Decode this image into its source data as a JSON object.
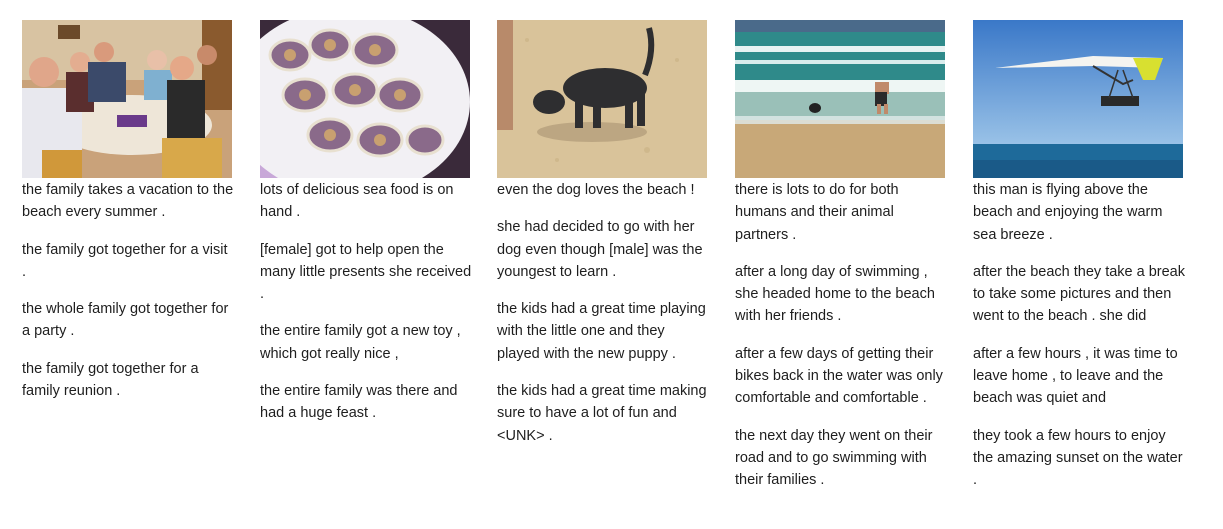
{
  "stories": [
    {
      "image": "family dinner around table",
      "captions": [
        "the family takes a vacation to the beach every summer .",
        "the family got together for a visit .",
        "the whole family got together for a party .",
        "the family got together for a family reunion ."
      ]
    },
    {
      "image": "plate of oysters",
      "captions": [
        "lots of delicious sea food is on hand .",
        "[female] got to help open the many little presents she received .",
        "the entire family got a new toy , which got really nice ,",
        "the entire family was there and had a huge feast ."
      ]
    },
    {
      "image": "dog sniffing sand on beach",
      "captions": [
        "even the dog loves the beach !",
        "she had decided to go with her dog even though [male] was the youngest to learn .",
        "the kids had a great time playing with the little one and they played with the new puppy .",
        "the kids had a great time making sure to have a lot of fun and <UNK> ."
      ]
    },
    {
      "image": "person and dog at shoreline",
      "captions": [
        "there is lots to do for both humans and their animal partners .",
        "after a long day of swimming , she headed home to the beach with her friends .",
        "after a few days of getting their bikes back in the water was only comfortable and comfortable .",
        "the next day they went on their road and to go swimming with their families ."
      ]
    },
    {
      "image": "hang glider over the sea",
      "captions": [
        "this man is flying above the beach and enjoying the warm sea breeze .",
        "after the beach they take a break to take some pictures and then went to the beach . she did",
        "after a few hours , it was time to leave home , to leave and the beach was quiet and",
        "they took a few hours to enjoy the amazing sunset on the water ."
      ]
    }
  ]
}
